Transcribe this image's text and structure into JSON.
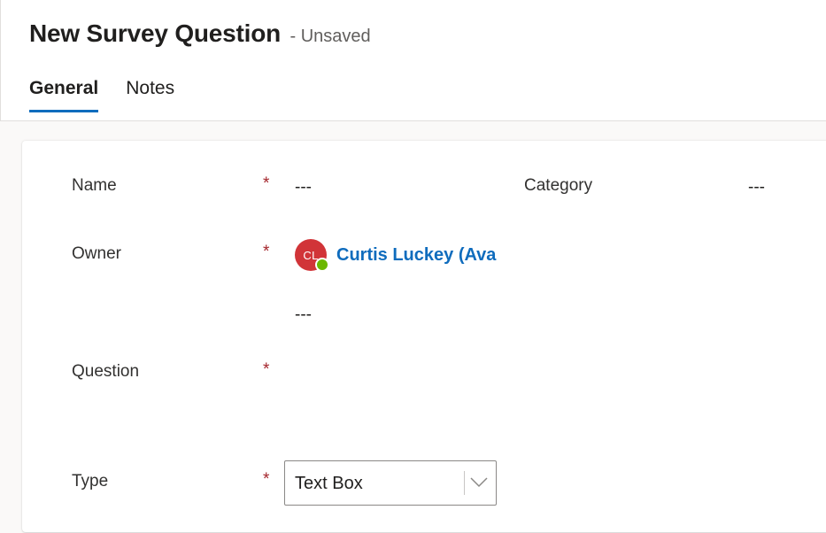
{
  "header": {
    "title": "New Survey Question",
    "status": "- Unsaved"
  },
  "tabs": [
    {
      "label": "General",
      "active": true
    },
    {
      "label": "Notes",
      "active": false
    }
  ],
  "form": {
    "required_marker": "*",
    "name": {
      "label": "Name",
      "value": "---"
    },
    "category": {
      "label": "Category",
      "value": "---"
    },
    "owner": {
      "label": "Owner",
      "initials": "CL",
      "display_name": "Curtis Luckey (Available)",
      "secondary_value": "---",
      "presence_color": "#6bb700",
      "avatar_color": "#d13438"
    },
    "question": {
      "label": "Question",
      "value": ""
    },
    "type": {
      "label": "Type",
      "value": "Text Box",
      "icon": "chevron-down-icon"
    }
  },
  "colors": {
    "accent": "#0f6cbd",
    "required": "#a4262c"
  }
}
